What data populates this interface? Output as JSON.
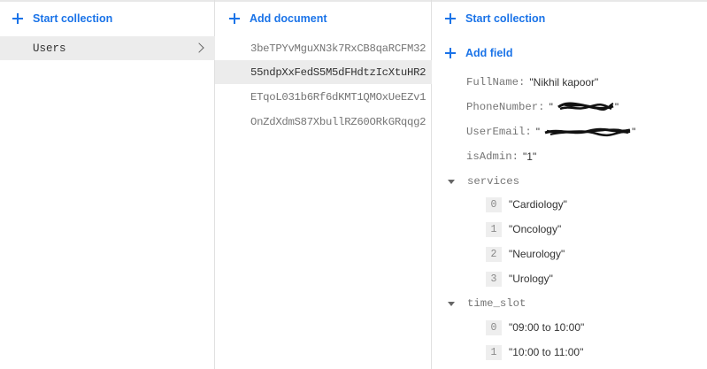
{
  "collections_panel": {
    "start_collection_label": "Start collection",
    "items": [
      {
        "name": "Users"
      }
    ]
  },
  "documents_panel": {
    "add_document_label": "Add document",
    "documents": [
      {
        "id": "3beTPYvMguXN3k7RxCB8qaRCFM32"
      },
      {
        "id": "55ndpXxFedS5M5dFHdtzIcXtuHR2"
      },
      {
        "id": "ETqoL031b6Rf6dKMT1QMOxUeEZv1"
      },
      {
        "id": "OnZdXdmS87XbullRZ60ORkGRqqg2"
      }
    ]
  },
  "fields_panel": {
    "start_collection_label": "Start collection",
    "add_field_label": "Add field",
    "fields": {
      "fullname": {
        "key": "FullName:",
        "value": "\"Nikhil kapoor\""
      },
      "phone": {
        "key": "PhoneNumber:",
        "quote_open": "\"",
        "quote_close": "\""
      },
      "email": {
        "key": "UserEmail:",
        "quote_open": "\"",
        "quote_close": "\""
      },
      "isadmin": {
        "key": "isAdmin:",
        "value": "\"1\""
      }
    },
    "services": {
      "key": "services",
      "items": [
        {
          "index": "0",
          "value": "\"Cardiology\""
        },
        {
          "index": "1",
          "value": "\"Oncology\""
        },
        {
          "index": "2",
          "value": "\"Neurology\""
        },
        {
          "index": "3",
          "value": "\"Urology\""
        }
      ]
    },
    "time_slot": {
      "key": "time_slot",
      "items": [
        {
          "index": "0",
          "value": "\"09:00 to 10:00\""
        },
        {
          "index": "1",
          "value": "\"10:00 to 11:00\""
        }
      ]
    }
  },
  "colors": {
    "accent": "#1a73e8",
    "selected_row": "#ececec",
    "divider": "#e0e0e0"
  }
}
